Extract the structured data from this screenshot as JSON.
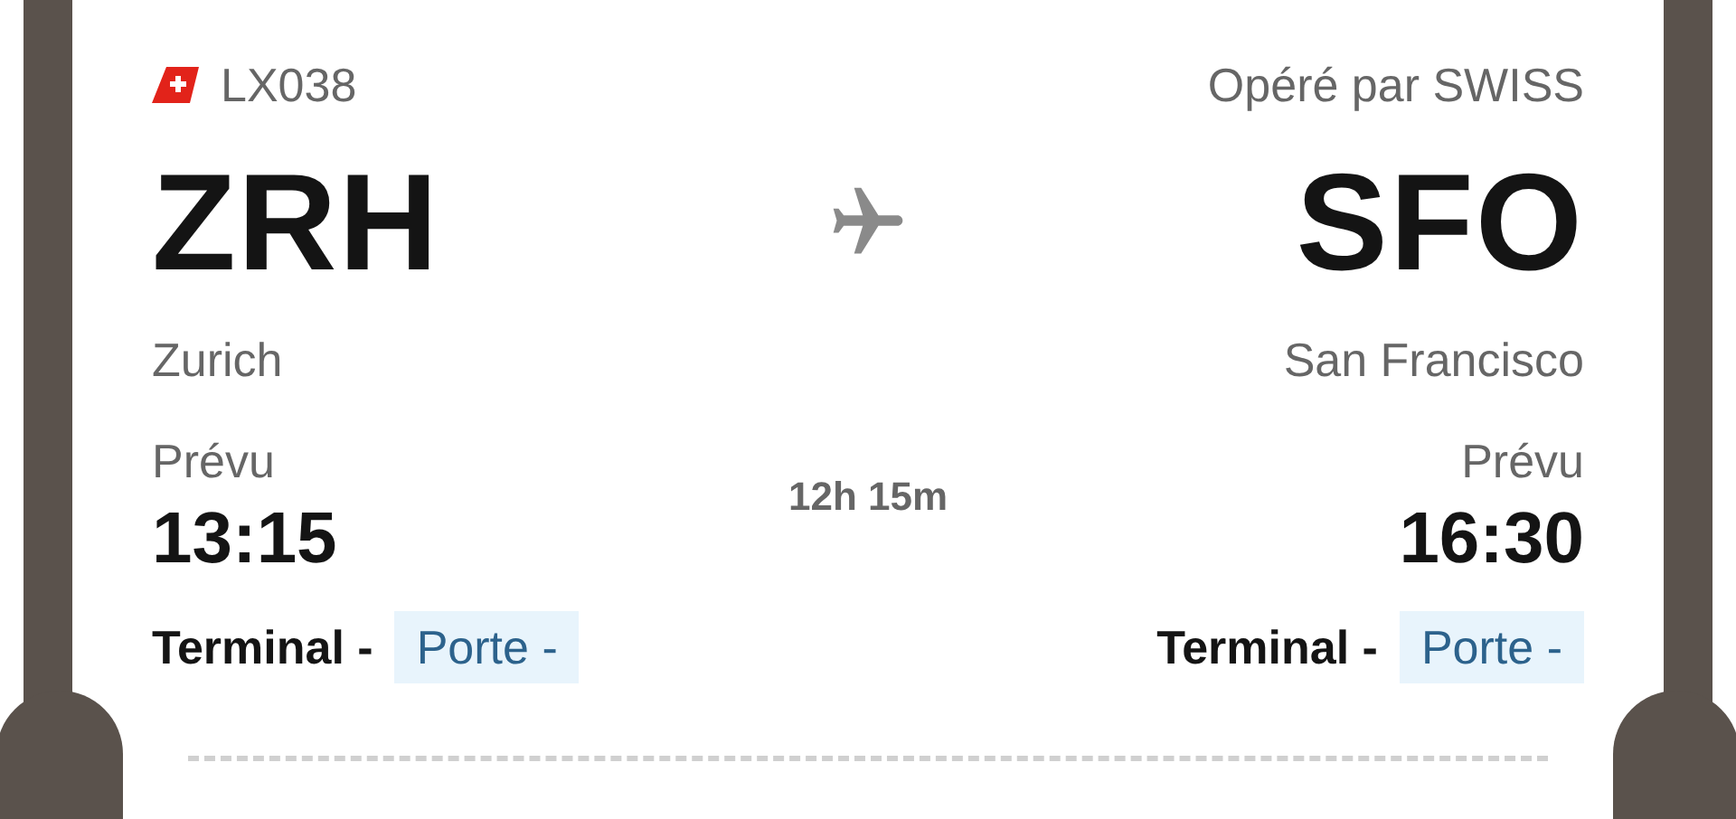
{
  "flight": {
    "number": "LX038",
    "operator": "Opéré par SWISS"
  },
  "departure": {
    "code": "ZRH",
    "city": "Zurich",
    "label": "Prévu",
    "time": "13:15",
    "terminal": "Terminal -",
    "gate": "Porte -"
  },
  "duration": "12h 15m",
  "arrival": {
    "code": "SFO",
    "city": "San Francisco",
    "label": "Prévu",
    "time": "16:30",
    "terminal": "Terminal -",
    "gate": "Porte -"
  }
}
